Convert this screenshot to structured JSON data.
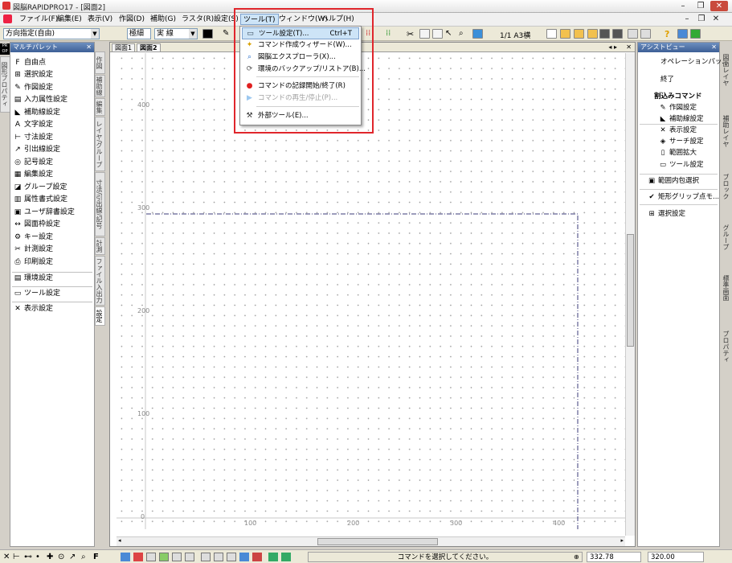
{
  "window": {
    "title": "図脳RAPIDPRO17 - [図面2]"
  },
  "menubar": {
    "items": [
      {
        "label": "ファイル(F)"
      },
      {
        "label": "編集(E)"
      },
      {
        "label": "表示(V)"
      },
      {
        "label": "作図(D)"
      },
      {
        "label": "補助(G)"
      },
      {
        "label": "ラスタ(R)"
      },
      {
        "label": "設定(S)"
      },
      {
        "label": "ツール(T)"
      },
      {
        "label": "ウィンドウ(W)"
      },
      {
        "label": "ヘルプ(H)"
      }
    ]
  },
  "toolbar": {
    "direction": "方向指定(自由)",
    "layer": "極細",
    "linetype": "実 線",
    "scale": "1/1 A3横"
  },
  "tools_menu": {
    "items": [
      {
        "label": "ツール設定(T)...",
        "shortcut": "Ctrl+T",
        "icon": "tool-settings-icon",
        "enabled": true
      },
      {
        "label": "コマンド作成ウィザード(W)...",
        "shortcut": "",
        "icon": "wizard-icon",
        "enabled": true
      },
      {
        "label": "図脳エクスプローラ(X)...",
        "shortcut": "",
        "icon": "explorer-icon",
        "enabled": true
      },
      {
        "label": "環境のバックアップ/リストア(B)...",
        "shortcut": "",
        "icon": "backup-icon",
        "enabled": true
      },
      {
        "label": "コマンドの記録開始/終了(R)",
        "shortcut": "",
        "icon": "record-icon",
        "enabled": true
      },
      {
        "label": "コマンドの再生/停止(P)...",
        "shortcut": "",
        "icon": "play-icon",
        "enabled": false
      },
      {
        "label": "外部ツール(E)...",
        "shortcut": "",
        "icon": "hammer-icon",
        "enabled": true
      }
    ]
  },
  "multi_palette": {
    "title": "マルチパレット",
    "items": [
      {
        "label": "自由点",
        "icon": "F"
      },
      {
        "label": "選択設定",
        "icon": "⊞"
      },
      {
        "label": "作図設定",
        "icon": "✎"
      },
      {
        "label": "入力属性設定",
        "icon": "▤"
      },
      {
        "label": "補助線設定",
        "icon": "◣"
      },
      {
        "label": "文字設定",
        "icon": "A"
      },
      {
        "label": "寸法設定",
        "icon": "⊢"
      },
      {
        "label": "引出線設定",
        "icon": "↗"
      },
      {
        "label": "記号設定",
        "icon": "◎"
      },
      {
        "label": "編集設定",
        "icon": "▦"
      },
      {
        "label": "グループ設定",
        "icon": "◪"
      },
      {
        "label": "属性書式設定",
        "icon": "▥"
      },
      {
        "label": "ユーザ辞書設定",
        "icon": "▣"
      },
      {
        "label": "図面枠設定",
        "icon": "↔"
      },
      {
        "label": "キー設定",
        "icon": "⚙"
      },
      {
        "label": "計測設定",
        "icon": "✂"
      },
      {
        "label": "印刷設定",
        "icon": "⎙"
      },
      {
        "label": "環境設定",
        "icon": "▤"
      },
      {
        "label": "ツール設定",
        "icon": "▭"
      },
      {
        "label": "表示設定",
        "icon": "✕"
      }
    ],
    "side_tabs": [
      "作図",
      "補助線",
      "編集",
      "レイヤ/グループ",
      "寸法/引出線/記号",
      "計測",
      "ファイル入出力",
      "設定"
    ]
  },
  "left_tabs": [
    "図形プロパティ"
  ],
  "document_tabs": [
    "図面1",
    "図面2"
  ],
  "canvas": {
    "y_labels": [
      "400",
      "300",
      "200",
      "100",
      "0"
    ],
    "x_labels": [
      "100",
      "200",
      "300",
      "400"
    ]
  },
  "assist_view": {
    "title": "アシストビュー",
    "items": [
      {
        "label": "オペレーションパッ...",
        "icon": ""
      },
      {
        "label": "終了",
        "icon": ""
      },
      {
        "label": "割込みコマンド",
        "icon": "",
        "bold": true
      },
      {
        "label": "作図設定",
        "icon": "✎"
      },
      {
        "label": "補助線設定",
        "icon": "◣"
      },
      {
        "label": "表示設定",
        "icon": "✕"
      },
      {
        "label": "サーチ設定",
        "icon": "◈"
      },
      {
        "label": "範囲拡大",
        "icon": "▯"
      },
      {
        "label": "ツール設定",
        "icon": "▭"
      },
      {
        "label": "範囲内包選択",
        "icon": "▣"
      },
      {
        "label": "矩形グリップ点モ...",
        "icon": "✔"
      },
      {
        "label": "選択設定",
        "icon": "⊞"
      }
    ]
  },
  "right_tabs": [
    "図面レイヤ",
    "補助レイヤ",
    "ブロック",
    "グループ",
    "標準画面",
    "プロパティ"
  ],
  "status": {
    "message": "コマンドを選択してください。",
    "x": "332.78",
    "y": "320.00"
  }
}
